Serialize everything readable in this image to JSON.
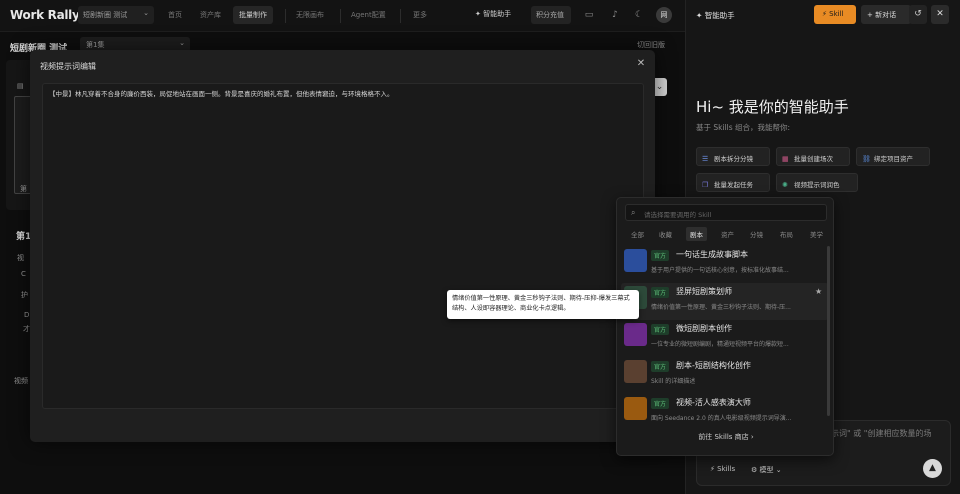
{
  "app": {
    "logo": "Work Rally"
  },
  "topbar": {
    "project_name": "短剧新圈 测试",
    "nav": [
      "首页",
      "资产库",
      "批量制作",
      "无限画布",
      "Agent配置",
      "更多"
    ],
    "assistant_label": "智能助手",
    "credits_label": "积分充值",
    "avatar_text": "网"
  },
  "workspace": {
    "title": "短剧新圈 测试",
    "episode": "第1集",
    "switch_version": "切回旧版",
    "frag1": "第",
    "frag2": "第1",
    "frag3": "视",
    "frag4": "C",
    "frag5": "护",
    "frag6": "D",
    "frag7": "才",
    "frag8": "视频"
  },
  "modal": {
    "title": "视频提示词编辑",
    "content": "【中景】林凡穿着不合身的廉价西装，局促地站在画面一侧。背景是喜庆的婚礼布置，但他表情窘迫，与环境格格不入。"
  },
  "assistant": {
    "title": "智能助手",
    "skill_button": "Skill",
    "new_chat_button": "新对话",
    "greeting": "Hi~ 我是你的智能助手",
    "subtitle": "基于 Skills 组合，我能帮你:",
    "chips": [
      {
        "label": "剧本拆分分镜",
        "icon": "list-icon"
      },
      {
        "label": "批量创建场次",
        "icon": "grid-icon"
      },
      {
        "label": "绑定项目资产",
        "icon": "link-icon"
      },
      {
        "label": "批量发起任务",
        "icon": "stack-icon"
      },
      {
        "label": "视频提示词润色",
        "icon": "sparkle-icon"
      }
    ],
    "input_hint": "示词\" 或 \"创建相应数量的场",
    "skills_label": "Skills",
    "model_label": "模型"
  },
  "skill_popup": {
    "search_placeholder": "请选择需要调用的 Skill",
    "tabs": [
      "全部",
      "收藏",
      "剧本",
      "资产",
      "分镜",
      "布局",
      "美学"
    ],
    "active_tab": "剧本",
    "badge": "官方",
    "items": [
      {
        "name": "一句话生成故事脚本",
        "desc": "基于用户提供的一句话核心创意，按标准化故事结...",
        "thumb_color": "#2b4e9c"
      },
      {
        "name": "竖屏短剧策划师",
        "desc": "情绪价值第一性原理、黄金三秒钩子法则、期待-压...",
        "thumb_color": "#2d4a3a"
      },
      {
        "name": "微短剧剧本创作",
        "desc": "一位专业的微短剧编剧，精通短视频平台的爆款短...",
        "thumb_color": "#6a2a8a"
      },
      {
        "name": "剧本-短剧结构化创作",
        "desc": "Skill 的详细描述",
        "thumb_color": "#5a4030"
      },
      {
        "name": "视频-活人感表演大师",
        "desc": "面向 Seedance 2.0 的真人电影级视频提示词导演...",
        "thumb_color": "#9a5a10"
      }
    ],
    "footer": "前往 Skills 商店"
  },
  "tooltip": {
    "text": "情绪价值第一性原理、黄金三秒钩子法则、期待-压抑-爆发三幕式结构、人设即容器理论、商业化卡点逻辑。"
  }
}
